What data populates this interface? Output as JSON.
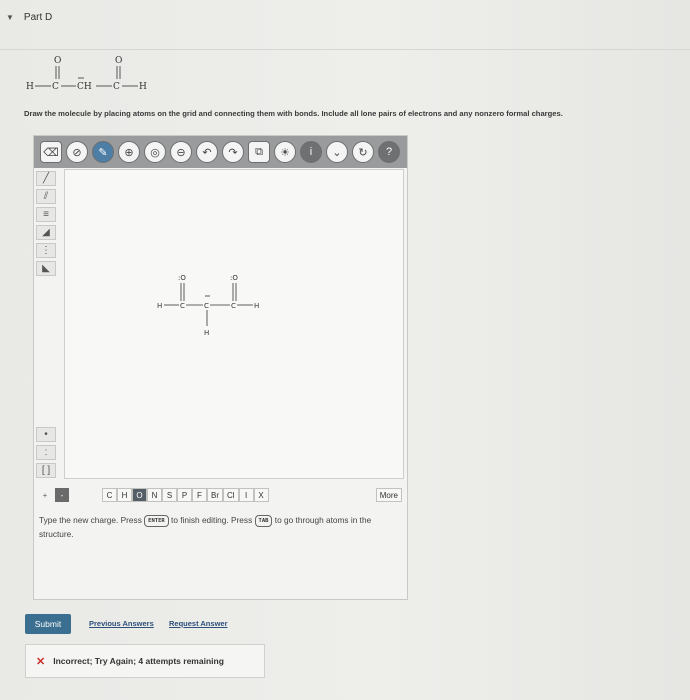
{
  "part": {
    "title": "Part D"
  },
  "question": {
    "formula_labels": {
      "o1": "O",
      "o2": "O",
      "h_left": "H",
      "c1": "C",
      "ch": "CH",
      "c2": "C",
      "h_right": "H"
    },
    "instructions": "Draw the molecule by placing atoms on the grid and connecting them with bonds. Include all lone pairs of electrons and any nonzero formal charges."
  },
  "toolbar": {
    "icons": [
      "eraser-icon",
      "pencil-icon",
      "zoom-in-icon",
      "zoom-fit-icon",
      "zoom-out-icon",
      "undo-icon",
      "redo-icon",
      "copy-icon",
      "lightbulb-icon",
      "info-icon",
      "chevron-down-icon",
      "reset-icon",
      "help-icon"
    ],
    "help_label": "?"
  },
  "drawing": {
    "o_left": ":O",
    "o_right": ":O",
    "h_left": "H",
    "c_left": "C",
    "c_mid": "C",
    "c_right": "C",
    "h_right": "H",
    "h_bottom": "H"
  },
  "atom_bar": {
    "plus": "+",
    "minus": "-",
    "atoms": [
      "C",
      "H",
      "O",
      "N",
      "S",
      "P",
      "F",
      "Br",
      "Cl",
      "I",
      "X"
    ],
    "selected": "O",
    "more": "More"
  },
  "hint": {
    "part1": "Type the new charge. Press",
    "key1": "ENTER",
    "part2": "to finish editing. Press",
    "key2": "TAB",
    "part3": "to go through atoms in the structure."
  },
  "actions": {
    "submit": "Submit",
    "previous_answers": "Previous Answers",
    "request_answer": "Request Answer"
  },
  "feedback": {
    "message": "Incorrect; Try Again; 4 attempts remaining",
    "icon": "x-icon",
    "color": "#c9302c"
  }
}
